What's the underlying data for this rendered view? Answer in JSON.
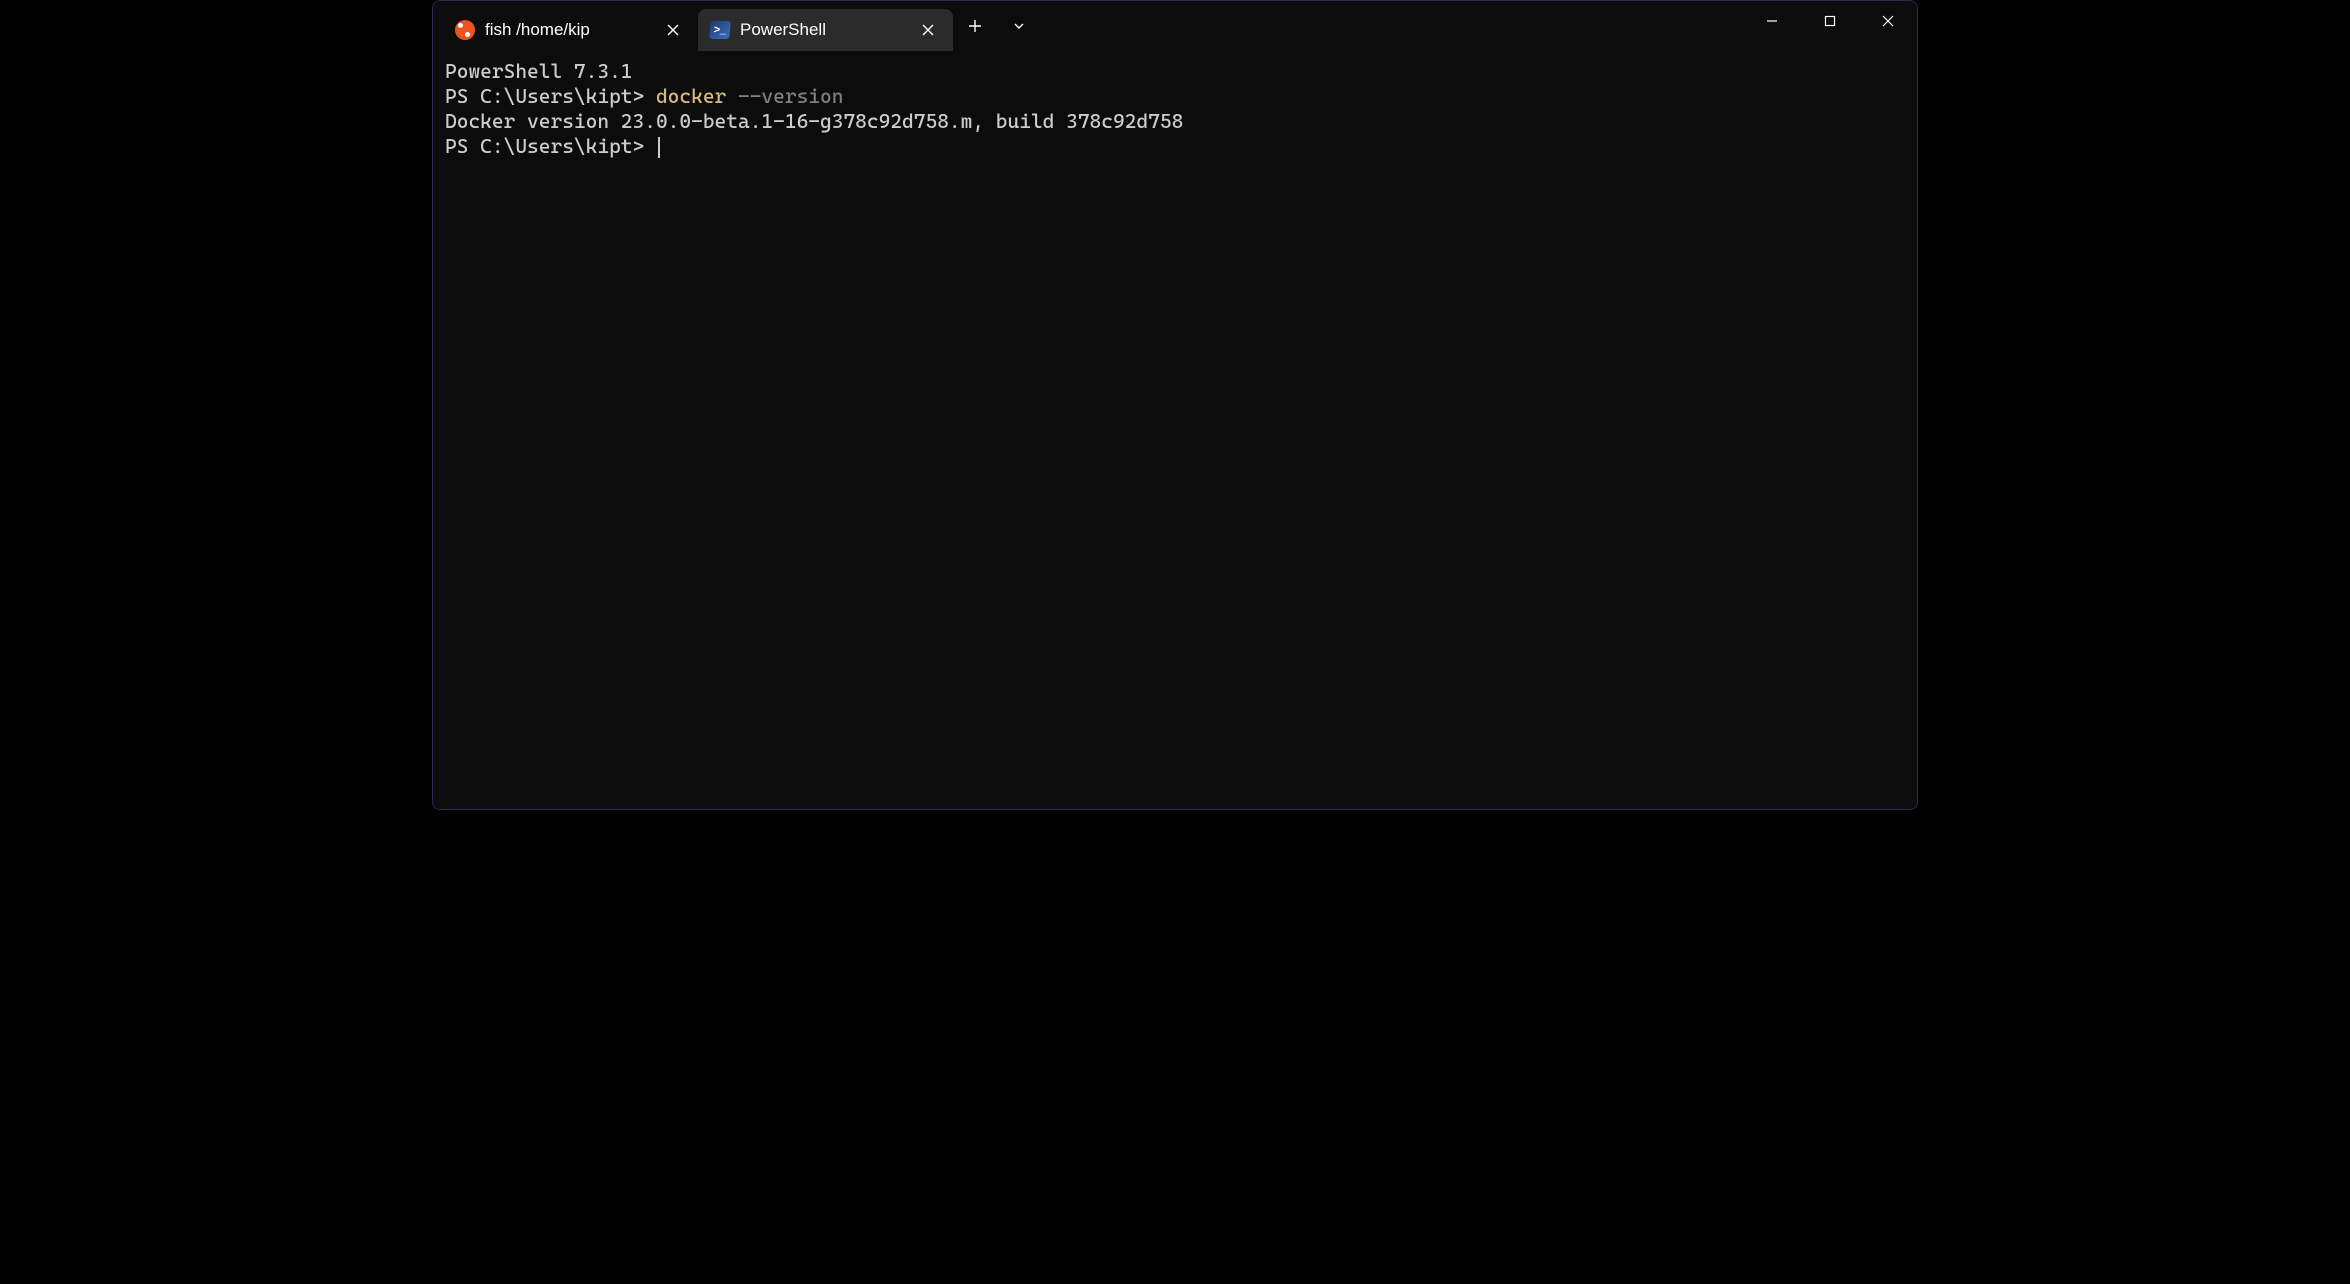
{
  "tabs": [
    {
      "label": "fish /home/kip",
      "icon": "ubuntu-icon",
      "active": false
    },
    {
      "label": "PowerShell",
      "icon": "powershell-icon",
      "active": true
    }
  ],
  "terminal": {
    "banner": "PowerShell 7.3.1",
    "lines": [
      {
        "prompt": "PS C:\\Users\\kipt>",
        "cmd": "docker",
        "arg": "--version"
      },
      {
        "output": "Docker version 23.0.0-beta.1-16-g378c92d758.m, build 378c92d758"
      },
      {
        "prompt": "PS C:\\Users\\kipt>",
        "cursor": true
      }
    ]
  },
  "colors": {
    "cmd": "#d7ba7d",
    "arg": "#808080"
  }
}
